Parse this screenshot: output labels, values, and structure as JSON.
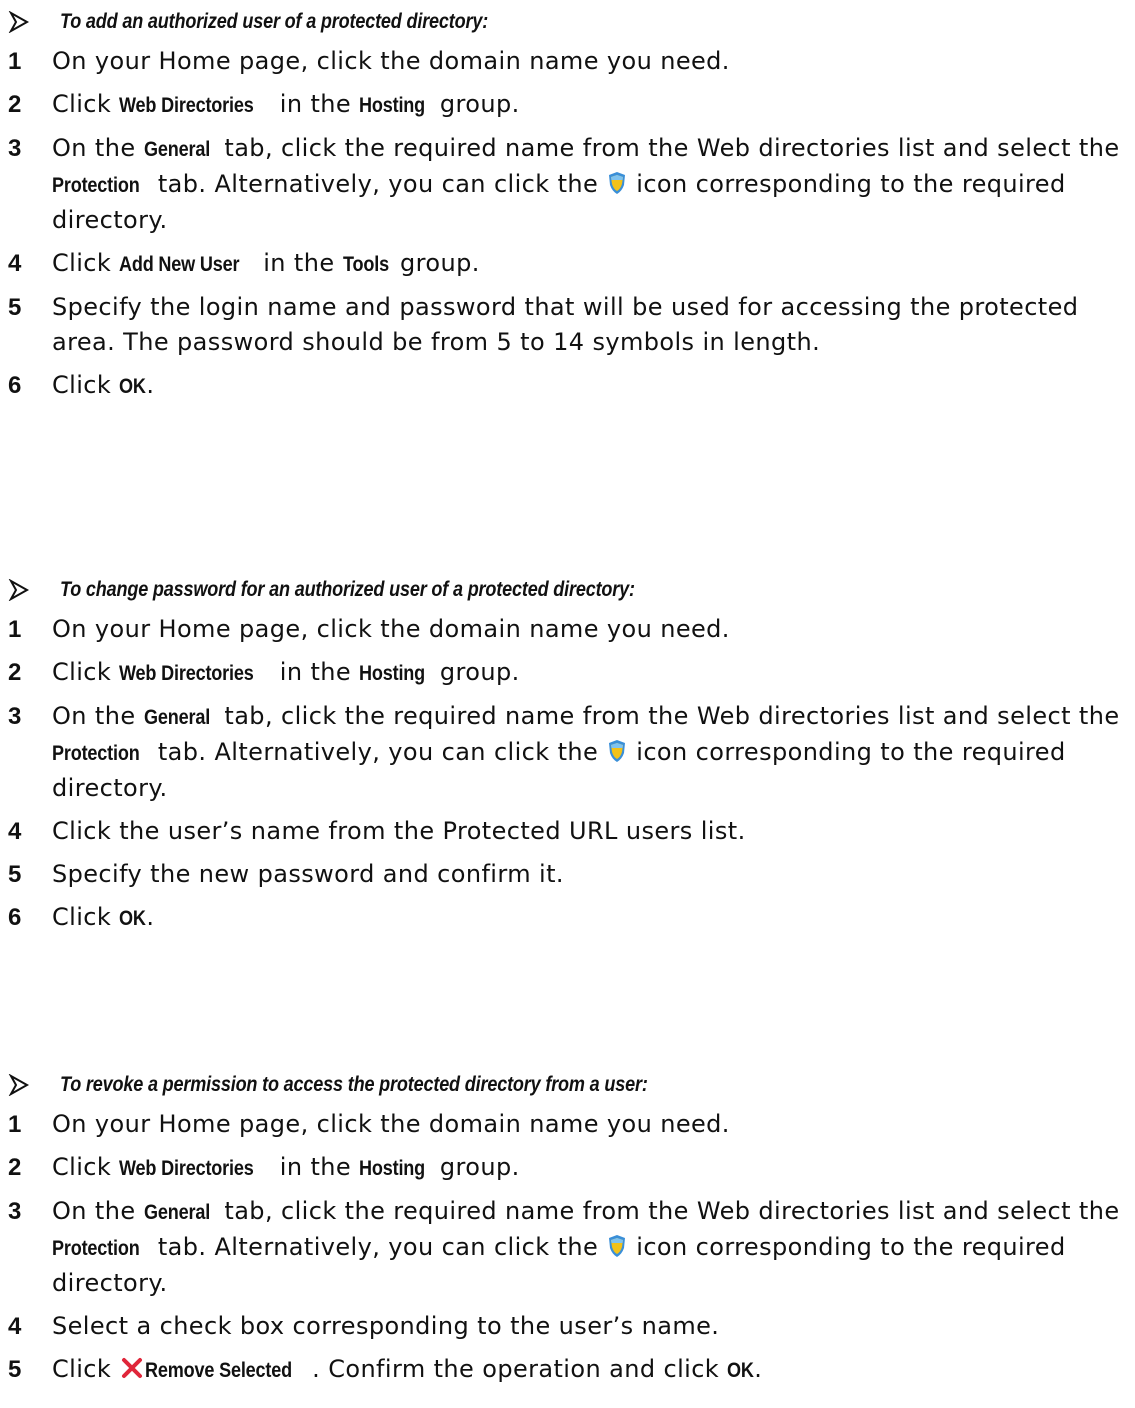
{
  "sections": [
    {
      "title": "To add an authorized user of a protected directory:",
      "steps": [
        {
          "num": "1",
          "parts": [
            {
              "t": "On your Home page, click the domain name you need."
            }
          ]
        },
        {
          "num": "2",
          "parts": [
            {
              "t": "Click "
            },
            {
              "b": "Web Directories"
            },
            {
              "t": " in the "
            },
            {
              "b": "Hosting"
            },
            {
              "t": " group."
            }
          ]
        },
        {
          "num": "3",
          "parts": [
            {
              "t": "On the "
            },
            {
              "b": "General"
            },
            {
              "t": " tab, click the required name from the Web directories list and select the "
            },
            {
              "b": "Protection"
            },
            {
              "t": " tab. Alternatively, you can click the "
            },
            {
              "icon": "shield-icon"
            },
            {
              "t": " icon corresponding to the required directory."
            }
          ]
        },
        {
          "num": "4",
          "parts": [
            {
              "t": "Click "
            },
            {
              "b": "Add New User"
            },
            {
              "t": " in the "
            },
            {
              "b": "Tools"
            },
            {
              "t": " group."
            }
          ]
        },
        {
          "num": "5",
          "parts": [
            {
              "t": "Specify the login name and password that will be used for accessing the protected area. The password should be from 5 to 14 symbols in length."
            }
          ]
        },
        {
          "num": "6",
          "parts": [
            {
              "t": "Click "
            },
            {
              "b": "OK"
            },
            {
              "t": "."
            }
          ]
        }
      ]
    },
    {
      "title": "To change password for an authorized user of a protected directory:",
      "steps": [
        {
          "num": "1",
          "parts": [
            {
              "t": "On your Home page, click the domain name you need."
            }
          ]
        },
        {
          "num": "2",
          "parts": [
            {
              "t": "Click "
            },
            {
              "b": "Web Directories"
            },
            {
              "t": " in the "
            },
            {
              "b": "Hosting"
            },
            {
              "t": " group."
            }
          ]
        },
        {
          "num": "3",
          "parts": [
            {
              "t": "On the "
            },
            {
              "b": "General"
            },
            {
              "t": " tab, click the required name from the Web directories list and select the "
            },
            {
              "b": "Protection"
            },
            {
              "t": " tab. Alternatively, you can click the "
            },
            {
              "icon": "shield-icon"
            },
            {
              "t": " icon corresponding to the required directory."
            }
          ]
        },
        {
          "num": "4",
          "parts": [
            {
              "t": "Click the user’s name from the Protected URL users list."
            }
          ]
        },
        {
          "num": "5",
          "parts": [
            {
              "t": "Specify the new password and confirm it."
            }
          ]
        },
        {
          "num": "6",
          "parts": [
            {
              "t": "Click "
            },
            {
              "b": "OK"
            },
            {
              "t": "."
            }
          ]
        }
      ]
    },
    {
      "title": "To revoke a permission to access the protected directory from a user:",
      "steps": [
        {
          "num": "1",
          "parts": [
            {
              "t": "On your Home page, click the domain name you need."
            }
          ]
        },
        {
          "num": "2",
          "parts": [
            {
              "t": "Click "
            },
            {
              "b": "Web Directories"
            },
            {
              "t": " in the "
            },
            {
              "b": "Hosting"
            },
            {
              "t": " group."
            }
          ]
        },
        {
          "num": "3",
          "parts": [
            {
              "t": "On the "
            },
            {
              "b": "General"
            },
            {
              "t": " tab, click the required name from the Web directories list and select the "
            },
            {
              "b": "Protection"
            },
            {
              "t": " tab. Alternatively, you can click the "
            },
            {
              "icon": "shield-icon"
            },
            {
              "t": " icon corresponding to the required directory."
            }
          ]
        },
        {
          "num": "4",
          "parts": [
            {
              "t": "Select a check box corresponding to the user’s name."
            }
          ]
        },
        {
          "num": "5",
          "parts": [
            {
              "t": "Click "
            },
            {
              "icon": "remove-x-icon"
            },
            {
              "b": "Remove Selected"
            },
            {
              "t": ". Confirm the operation and click "
            },
            {
              "b": "OK"
            },
            {
              "t": "."
            }
          ]
        }
      ]
    }
  ],
  "colors": {
    "text": "#111111",
    "shield_blue": "#3a8fd8",
    "shield_yellow": "#f2c21a",
    "remove_red": "#e0263a"
  }
}
